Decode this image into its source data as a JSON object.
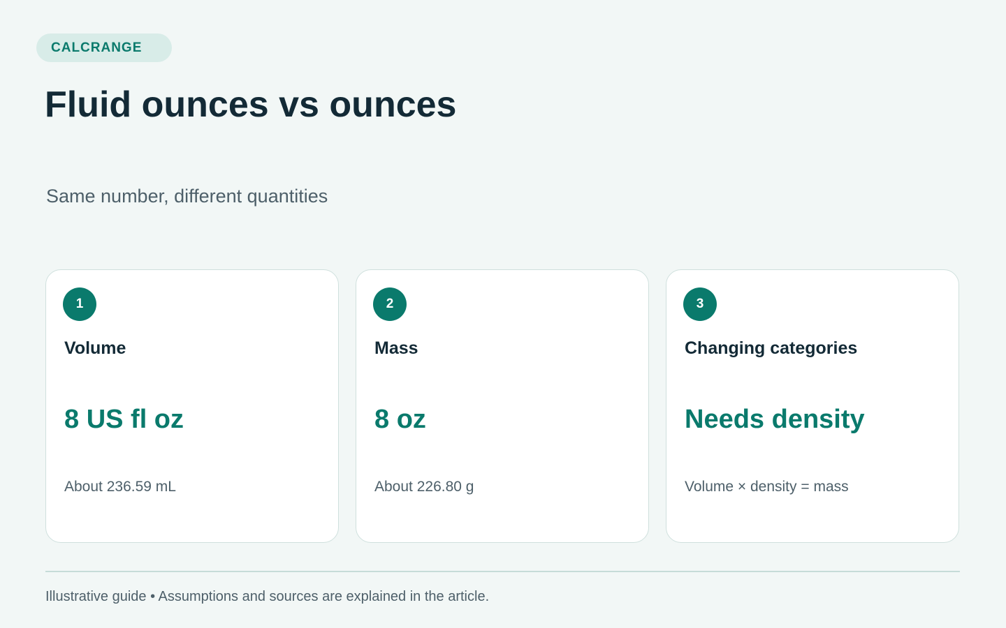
{
  "brand": {
    "label": "CALCRANGE"
  },
  "header": {
    "title": "Fluid ounces vs ounces",
    "subtitle": "Same number, different quantities"
  },
  "cards": [
    {
      "step": "1",
      "heading": "Volume",
      "value": "8 US fl oz",
      "note": "About 236.59 mL"
    },
    {
      "step": "2",
      "heading": "Mass",
      "value": "8 oz",
      "note": "About 226.80 g"
    },
    {
      "step": "3",
      "heading": "Changing categories",
      "value": "Needs density",
      "note": "Volume × density = mass"
    }
  ],
  "footer": {
    "note": "Illustrative guide • Assumptions and sources are explained in the article."
  },
  "colors": {
    "background": "#f2f7f6",
    "accent": "#0a7a6c",
    "pill_background": "#d8ece8",
    "heading_text": "#132a36",
    "muted_text": "#4d5f69",
    "card_border": "#cfe0dd"
  }
}
